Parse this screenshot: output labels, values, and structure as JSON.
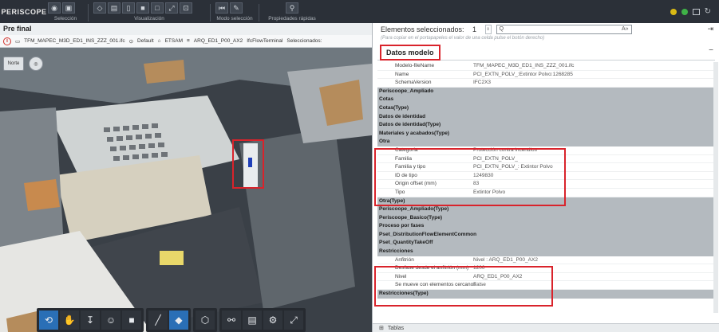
{
  "app": {
    "logo_text": "PERISCOPE"
  },
  "toolbar": {
    "groups": [
      {
        "label": "Selección",
        "icons": [
          "eye-icon",
          "cube-icon"
        ]
      },
      {
        "label": "Visualización",
        "icons": [
          "box-icon",
          "layers-icon",
          "page-icon",
          "square-icon",
          "outline-icon",
          "expand-icon",
          "fit-icon"
        ]
      },
      {
        "label": "Modo selección",
        "icons": [
          "rewind-icon",
          "pencil-icon"
        ]
      },
      {
        "label": "Propiedades rápidas",
        "icons": [
          "quick-properties-icon"
        ]
      }
    ],
    "right_icons": [
      "status-yellow",
      "status-green",
      "window-icon",
      "refresh-icon"
    ],
    "colors": {
      "status_yellow": "#d9b915",
      "status_green": "#3fb247",
      "selected": "#1b73c9"
    }
  },
  "view": {
    "title": "Pre final",
    "breadcrumb": [
      "TFM_MAPEC_M3D_ED1_INS_ZZZ_001.ifc",
      "Default",
      "ETSAM",
      "ARQ_ED1_P00_AX2",
      "IfcFlowTerminal",
      "Seleccionados:"
    ],
    "nav_buttons": [
      "Norte",
      ""
    ]
  },
  "bottom_toolbar": [
    [
      "orbit-icon",
      "pan-icon",
      "walk-icon",
      "person-icon",
      "camera-icon"
    ],
    [
      "measure-icon",
      "section-icon"
    ],
    [
      "cube-view-icon"
    ],
    [
      "tree-icon",
      "properties-icon",
      "settings-icon",
      "fullscreen-icon"
    ]
  ],
  "panel": {
    "selected_label": "Elementos seleccionados:",
    "selected_count": "1",
    "search_placeholder": "Q",
    "search_suffix": "A»",
    "hint": "(Para copiar en el portapapeles el valor de una celda pulse el botón derecho)",
    "section_title": "Datos modelo",
    "rows": [
      {
        "type": "prop",
        "k": "Modelo-fileName",
        "v": "TFM_MAPEC_M3D_ED1_INS_ZZZ_001.ifc"
      },
      {
        "type": "prop",
        "k": "Name",
        "v": "PCI_EXTN_POLV_:Extintor Polvo:1268285"
      },
      {
        "type": "prop",
        "k": "SchemaVersion",
        "v": "IFC2X3"
      },
      {
        "type": "cat",
        "k": "Periscoope_Ampliado"
      },
      {
        "type": "cat",
        "k": "Cotas"
      },
      {
        "type": "cat",
        "k": "Cotas(Type)"
      },
      {
        "type": "cat",
        "k": "Datos de identidad"
      },
      {
        "type": "cat",
        "k": "Datos de identidad(Type)"
      },
      {
        "type": "cat",
        "k": "Materiales y acabados(Type)"
      },
      {
        "type": "cat",
        "k": "Otra"
      },
      {
        "type": "prop",
        "k": "Categoría",
        "v": "Protección contra incendios"
      },
      {
        "type": "prop",
        "k": "Familia",
        "v": "PCI_EXTN_POLV_"
      },
      {
        "type": "prop",
        "k": "Familia y tipo",
        "v": "PCI_EXTN_POLV_: Extintor Polvo"
      },
      {
        "type": "prop",
        "k": "ID de tipo",
        "v": "1249830"
      },
      {
        "type": "prop",
        "k": "Origin offset (mm)",
        "v": "83"
      },
      {
        "type": "prop",
        "k": "Tipo",
        "v": "Extintor Polvo"
      },
      {
        "type": "cat",
        "k": "Otra(Type)"
      },
      {
        "type": "cat",
        "k": "Periscoope_Ampliado(Type)"
      },
      {
        "type": "cat",
        "k": "Periscoope_Basico(Type)"
      },
      {
        "type": "cat",
        "k": "Proceso por fases"
      },
      {
        "type": "cat",
        "k": "Pset_DistributionFlowElementCommon"
      },
      {
        "type": "cat",
        "k": "Pset_QuantityTakeOff"
      },
      {
        "type": "cat",
        "k": "Restricciones"
      },
      {
        "type": "prop",
        "k": "Anfitrión",
        "v": "Nivel : ARQ_ED1_P00_AX2"
      },
      {
        "type": "prop",
        "k": "Desfase desde el anfitrión (mm)",
        "v": "1200"
      },
      {
        "type": "prop",
        "k": "Nivel",
        "v": "ARQ_ED1_P00_AX2"
      },
      {
        "type": "prop",
        "k": "Se mueve con elementos cercanos",
        "v": "False"
      },
      {
        "type": "cat",
        "k": "Restricciones(Type)"
      }
    ],
    "bottom_tab": "Tablas"
  }
}
